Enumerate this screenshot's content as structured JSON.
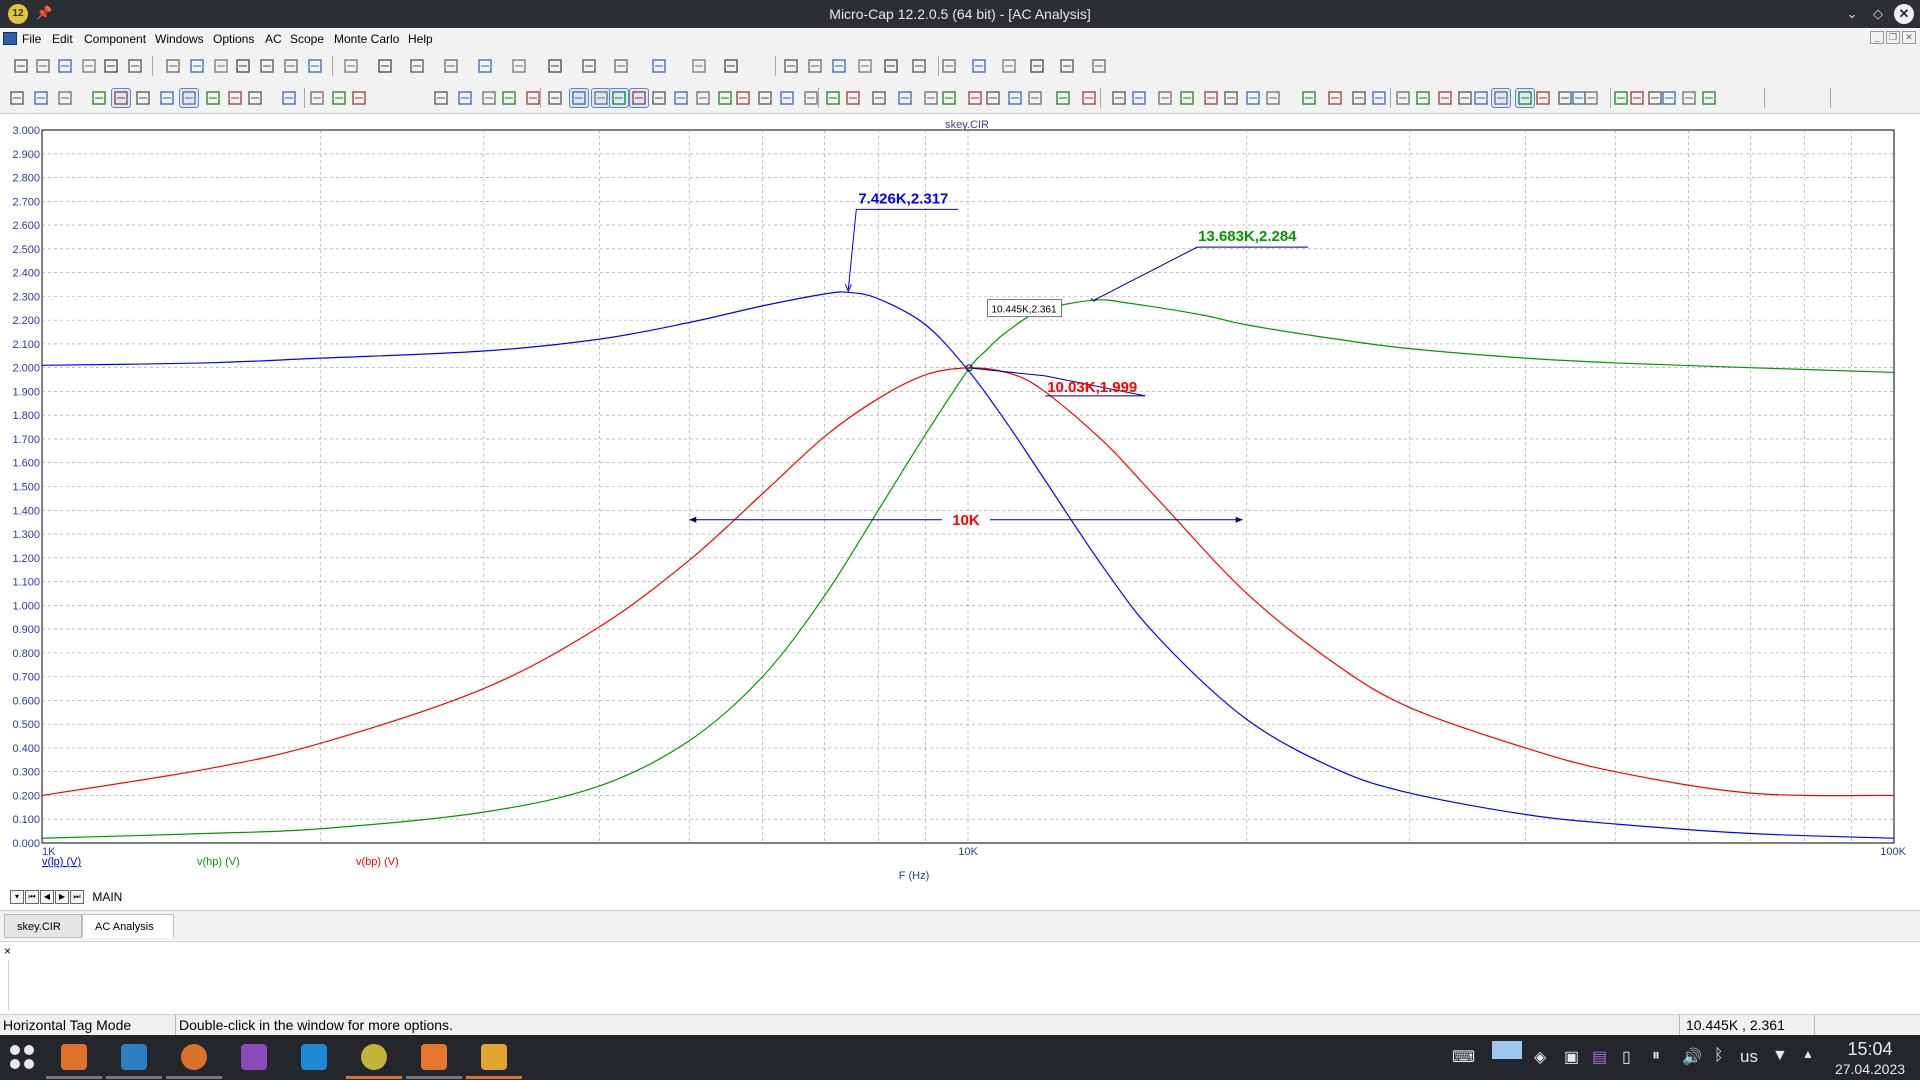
{
  "window": {
    "title": "Micro-Cap 12.2.0.5 (64 bit) - [AC Analysis]",
    "app_badge": "12"
  },
  "menu": [
    "File",
    "Edit",
    "Component",
    "Windows",
    "Options",
    "AC",
    "Scope",
    "Monte Carlo",
    "Help"
  ],
  "chart_data": {
    "type": "line",
    "title": "skey.CIR",
    "xlabel": "F (Hz)",
    "x_scale": "log",
    "xlim": [
      1000,
      100000
    ],
    "ylim": [
      0,
      3
    ],
    "x_tick_labels": [
      "1K",
      "10K",
      "100K"
    ],
    "y_tick_labels": [
      "0.000",
      "0.100",
      "0.200",
      "0.300",
      "0.400",
      "0.500",
      "0.600",
      "0.700",
      "0.800",
      "0.900",
      "1.000",
      "1.100",
      "1.200",
      "1.300",
      "1.400",
      "1.500",
      "1.600",
      "1.700",
      "1.800",
      "1.900",
      "2.000",
      "2.100",
      "2.200",
      "2.300",
      "2.400",
      "2.500",
      "2.600",
      "2.700",
      "2.800",
      "2.900",
      "3.000"
    ],
    "grid": true,
    "series": [
      {
        "name": "v(lp) (V)",
        "color": "#0000ff",
        "x": [
          1000,
          1500,
          2000,
          3000,
          4000,
          5000,
          6000,
          7000,
          7426,
          8000,
          9000,
          10000,
          11000,
          12000,
          14000,
          16000,
          20000,
          25000,
          30000,
          40000,
          50000,
          70000,
          100000
        ],
        "y": [
          2.01,
          2.02,
          2.04,
          2.07,
          2.12,
          2.19,
          2.26,
          2.31,
          2.317,
          2.29,
          2.18,
          1.99,
          1.77,
          1.55,
          1.16,
          0.87,
          0.52,
          0.31,
          0.21,
          0.12,
          0.08,
          0.04,
          0.02
        ]
      },
      {
        "name": "v(hp) (V)",
        "color": "#009900",
        "x": [
          1000,
          1500,
          2000,
          3000,
          4000,
          5000,
          6000,
          7000,
          8000,
          9000,
          10000,
          10445,
          11000,
          12000,
          13683,
          15000,
          18000,
          20000,
          25000,
          30000,
          40000,
          50000,
          70000,
          100000
        ],
        "y": [
          0.02,
          0.04,
          0.06,
          0.13,
          0.24,
          0.43,
          0.7,
          1.04,
          1.4,
          1.72,
          1.99,
          2.07,
          2.15,
          2.24,
          2.284,
          2.27,
          2.22,
          2.18,
          2.12,
          2.08,
          2.04,
          2.02,
          2.0,
          1.98
        ]
      },
      {
        "name": "v(bp) (V)",
        "color": "#ff0000",
        "x": [
          1000,
          1500,
          2000,
          3000,
          4000,
          5000,
          6000,
          7000,
          8000,
          9000,
          10000,
          11000,
          12000,
          14000,
          16000,
          20000,
          25000,
          30000,
          40000,
          50000,
          70000,
          100000
        ],
        "y": [
          0.2,
          0.31,
          0.42,
          0.65,
          0.91,
          1.19,
          1.47,
          1.71,
          1.87,
          1.97,
          1.999,
          1.98,
          1.91,
          1.69,
          1.45,
          1.05,
          0.75,
          0.57,
          0.4,
          0.3,
          0.21,
          0.2
        ]
      }
    ],
    "annotations": [
      {
        "text": "7.426K,2.317",
        "x": 7426,
        "y": 2.317,
        "color": "#0000ff"
      },
      {
        "text": "13.683K,2.284",
        "x": 13683,
        "y": 2.284,
        "color": "#009900"
      },
      {
        "text": "10.03K,1.999",
        "x": 10030,
        "y": 1.999,
        "color": "#ff0000"
      },
      {
        "text": "10.445K,2.361",
        "x": 10445,
        "y": 2.0,
        "color": "#000000"
      }
    ],
    "bandwidth": {
      "text": "10K",
      "x_from": 5000,
      "x_to": 19800,
      "y": 1.36,
      "color": "#ff0000"
    }
  },
  "sheet": {
    "name": "MAIN"
  },
  "tabs": [
    "skey.CIR",
    "AC Analysis"
  ],
  "output": {
    "close": "×"
  },
  "status": {
    "mode": "Horizontal Tag Mode",
    "hint": "Double-click in the window for more options.",
    "coords": "10.445K , 2.361"
  },
  "taskbar": {
    "lang": "us",
    "time": "15:04",
    "date": "27.04.2023"
  },
  "colors": {
    "accent": "#e0732c",
    "lp": "#0000ff",
    "hp": "#009900",
    "bp": "#ff0000"
  }
}
